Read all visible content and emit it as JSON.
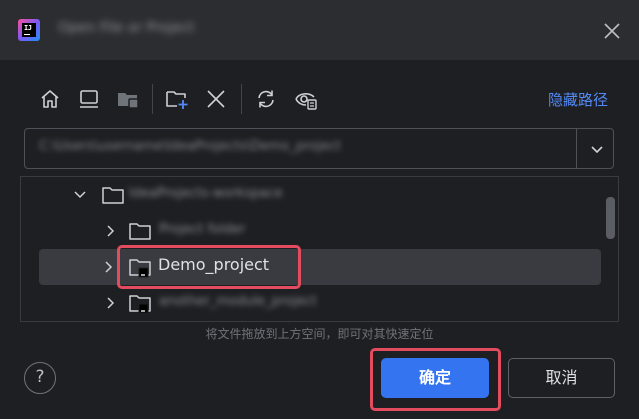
{
  "window": {
    "title": "Open File or Project",
    "logo_text": "IJ"
  },
  "toolbar": {
    "icons": [
      "home-icon",
      "desktop-icon",
      "project-folder-icon",
      "new-folder-icon",
      "delete-icon",
      "refresh-icon",
      "show-hidden-icon"
    ],
    "hide_path_label": "隐藏路径"
  },
  "path_field": {
    "value": "C:\\Users\\username\\IdeaProjects\\Demo_project"
  },
  "tree": {
    "rows": [
      {
        "label": "IdeaProjects-workspace",
        "blurred": true,
        "expanded": true,
        "level": 0
      },
      {
        "label": "Project folder",
        "blurred": true,
        "expanded": false,
        "level": 1
      },
      {
        "label": "Demo_project",
        "blurred": false,
        "expanded": false,
        "level": 1,
        "selected": true,
        "module": true
      },
      {
        "label": "another_module_project",
        "blurred": true,
        "expanded": false,
        "level": 1,
        "module": true
      }
    ]
  },
  "hint": "将文件拖放到上方空间，即可对其快速定位",
  "buttons": {
    "help": "?",
    "ok": "确定",
    "cancel": "取消"
  },
  "colors": {
    "accent": "#3574f0",
    "link": "#548af7",
    "highlight": "#e34b5e",
    "background": "#1e1f22"
  }
}
